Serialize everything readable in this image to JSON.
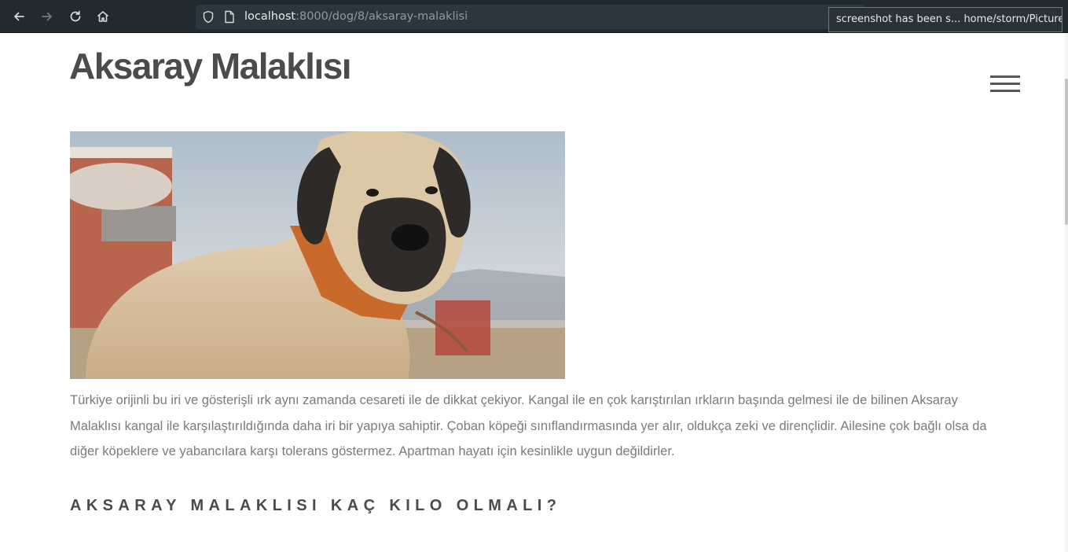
{
  "browser": {
    "url_host": "localhost",
    "url_path": ":8000/dog/8/aksaray-malaklisi",
    "notification": "screenshot has been s... home/storm/Pictures",
    "icons": [
      "back-arrow-icon",
      "forward-arrow-icon",
      "reload-icon",
      "home-icon",
      "shield-icon",
      "page-icon"
    ]
  },
  "page": {
    "title": "Aksaray Malaklısı",
    "intro": "Türkiye orijinli bu iri ve gösterişli ırk aynı zamanda cesareti ile de dikkat çekiyor. Kangal ile en çok karıştırılan ırkların başında gelmesi ile de bilinen Aksaray Malaklısı kangal ile karşılaştırıldığında daha iri bir yapıya sahiptir. Çoban köpeği sınıflandırmasında yer alır, oldukça zeki ve dirençlidir. Ailesine çok bağlı olsa da diğer köpeklere ve yabancılara karşı tolerans göstermez. Apartman hayatı için kesinlikle uygun değildirler.",
    "section_heading": "AKSARAY MALAKLISI KAÇ KILO OLMALI?",
    "menu_icon": "hamburger-menu-icon",
    "image": "dog-photo"
  }
}
